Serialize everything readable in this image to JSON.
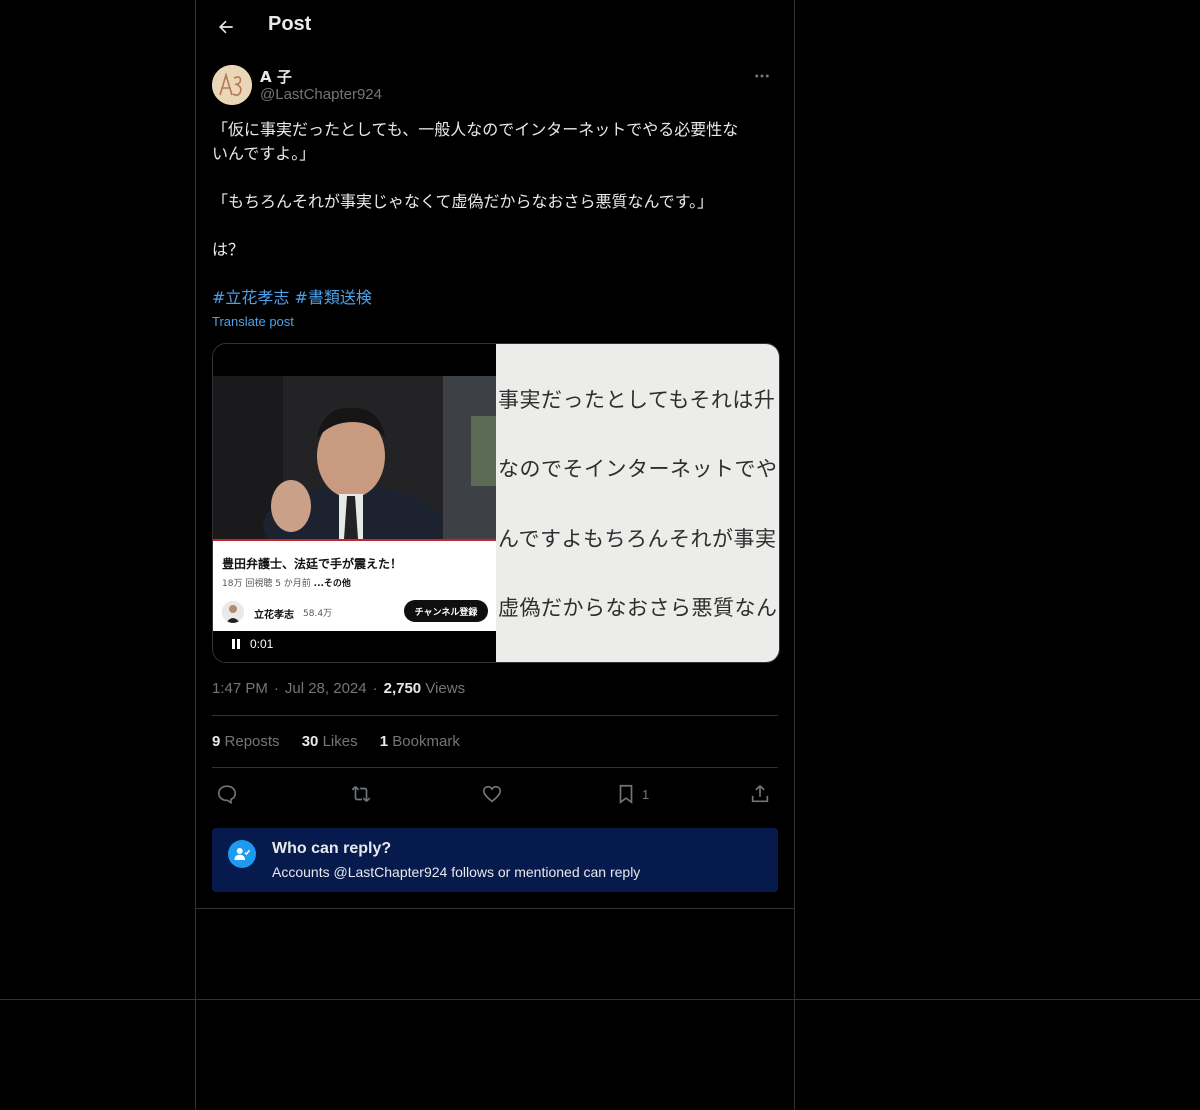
{
  "header": {
    "title": "Post"
  },
  "author": {
    "name": "A 子",
    "handle": "@LastChapter924"
  },
  "post": {
    "lines": [
      "「仮に事実だったとしても、一般人なのでインターネットでやる必要性な",
      "いんですよ。」",
      "「もちろんそれが事実じゃなくて虚偽だからなおさら悪質なんです。」",
      "は？"
    ],
    "hashtags": [
      "#立花孝志",
      "#書類送検"
    ],
    "translate_label": "Translate post"
  },
  "video": {
    "card_title": "豊田弁護士、法廷で手が震えた！",
    "card_views": "18万 回視聴",
    "card_age": "5 か月前",
    "card_more": "...その他",
    "channel_name": "立花孝志",
    "channel_subs": "58.4万",
    "subscribe_label": "チャンネル登録",
    "time": "0:01",
    "subtitles": [
      "事実だったとしてもそれは升",
      "なのでそインターネットでや",
      "んですよもちろんそれが事実",
      "虚偽だからなおさら悪質なん"
    ]
  },
  "meta": {
    "time": "1:47 PM",
    "date": "Jul 28, 2024",
    "views_count": "2,750",
    "views_label": "Views"
  },
  "stats": {
    "reposts_count": "9",
    "reposts_label": "Reposts",
    "likes_count": "30",
    "likes_label": "Likes",
    "bookmarks_count": "1",
    "bookmarks_label": "Bookmark"
  },
  "actions": {
    "bookmark_count": "1"
  },
  "reply_restriction": {
    "title": "Who can reply?",
    "description": "Accounts @LastChapter924 follows or mentioned can reply"
  },
  "colors": {
    "accent": "#1d9bf0",
    "link": "#4ea0e8",
    "reply_box_bg": "#061a4d"
  }
}
